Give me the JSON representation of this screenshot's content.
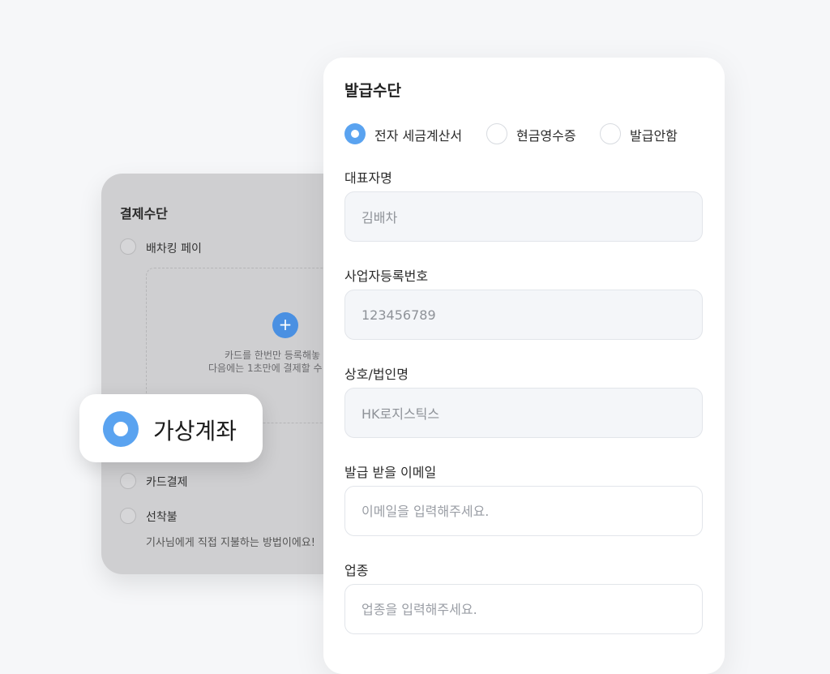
{
  "payment_card": {
    "title": "결제수단",
    "option1_label": "배차킹 페이",
    "hint_line1": "카드를 한번만 등록해놓",
    "hint_line2": "다음에는 1초만에 결제할 수",
    "option3_label": "카드결제",
    "option4_label": "선착불",
    "option4_note": "기사님에게 직접 지불하는 방법이에요!"
  },
  "pill": {
    "label": "가상계좌"
  },
  "form": {
    "title": "발급수단",
    "options": [
      {
        "label": "전자 세금계산서",
        "selected": true
      },
      {
        "label": "현금영수증",
        "selected": false
      },
      {
        "label": "발급안함",
        "selected": false
      }
    ],
    "fields": [
      {
        "label": "대표자명",
        "value": "김배차",
        "placeholder": ""
      },
      {
        "label": "사업자등록번호",
        "value": "123456789",
        "placeholder": ""
      },
      {
        "label": "상호/법인명",
        "value": "HK로지스틱스",
        "placeholder": ""
      },
      {
        "label": "발급 받을 이메일",
        "value": "",
        "placeholder": "이메일을 입력해주세요."
      },
      {
        "label": "업종",
        "value": "",
        "placeholder": "업종을 입력해주세요."
      }
    ]
  },
  "colors": {
    "accent": "#5aa3f0",
    "back_card": "#cfcfd1"
  }
}
